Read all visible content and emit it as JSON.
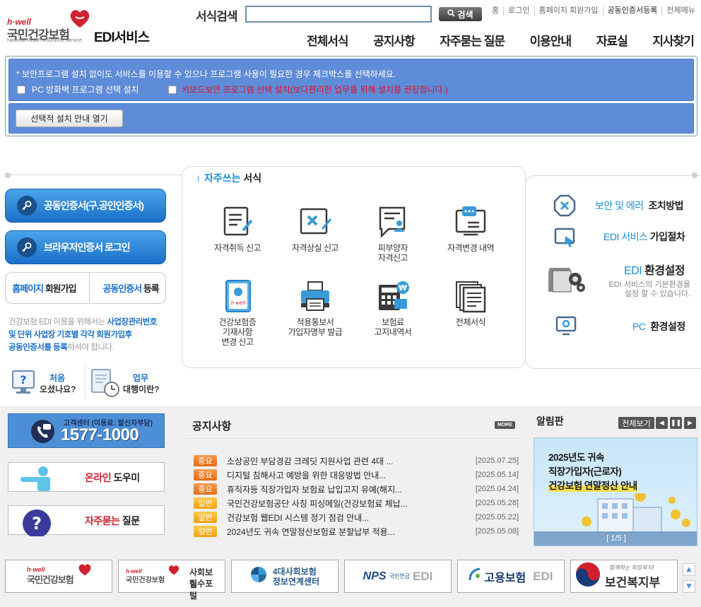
{
  "header": {
    "logo_hwell": "h·well",
    "logo_kr": "국민건강보험",
    "logo_en": "National Health Insurance Service",
    "logo_service": "EDI서비스",
    "search_label": "서식검색",
    "search_value": "",
    "search_button": "검색",
    "util_links": [
      "홈",
      "로그인",
      "홈페이지 회원가입",
      "공동인증서등록",
      "전체메뉴"
    ],
    "gnb": [
      "전체서식",
      "공지사항",
      "자주묻는 질문",
      "이용안내",
      "자료실",
      "지사찾기"
    ]
  },
  "install": {
    "notice": "* 보안프로그램 설치 없이도 서비스를 이용할 수 있으나 프로그램 사용이 필요한 경우 체크박스를 선택하세요.",
    "option1": "PC 방화벽 프로그램 선택 설치",
    "option2": "키보드보안 프로그램 선택 설치(보다편리한 업무를 위해 설치를 권장합니다.)",
    "guide_button": "선택적 설치 안내 열기"
  },
  "left": {
    "cert_login": "공동인증서(구.공인인증서)",
    "browser_login": "브라우저인증서 로그인",
    "join_a": "홈페이지",
    "join_b": "회원가입",
    "reg_a": "공동인증서",
    "reg_b": "등록",
    "guide_1": "건강보험 EDI 이용을 위해서는",
    "guide_1b": "사업장관리번호",
    "guide_2": "및 단위 사업장 기호별 각각 회원가입후",
    "guide_3": "공동인증서를 등록",
    "guide_3b": "하셔야 합니다.",
    "first_t1": "처음",
    "first_t2": "오셨나요?",
    "agency_t1": "업무",
    "agency_t2": "대행이란?"
  },
  "forms": {
    "title_hl": "자주쓰는",
    "title": "서식",
    "items": [
      {
        "label": "자격취득 신고"
      },
      {
        "label": "자격상실 신고"
      },
      {
        "label": "피부양자\n자격신고"
      },
      {
        "label": "자격변경 내역"
      },
      {
        "label": "건강보험증\n기재사항\n변경 신고"
      },
      {
        "label": "적용통보서\n가입자명부 발급"
      },
      {
        "label": "보험료\n고지내역서"
      },
      {
        "label": "전체서식"
      }
    ]
  },
  "right": {
    "error_a": "보안 및 에러",
    "error_b": "조치방법",
    "join_a": "EDI 서비스",
    "join_b": "가입절차",
    "env_a": "EDI",
    "env_b": "환경설정",
    "env_desc1": "EDI 서비스의 기본환경을",
    "env_desc2": "설정 할 수 있습니다.",
    "pc_a": "PC",
    "pc_b": "환경설정"
  },
  "callcenter": {
    "label": "고객센터 (이용료: 발신자부담)",
    "number": "1577-1000"
  },
  "helper_a": "온라인",
  "helper_b": "도우미",
  "faq_a": "자주묻는",
  "faq_b": "질문",
  "notice": {
    "title": "공지사항",
    "more": "MORE",
    "rows": [
      {
        "badge": "중요",
        "type": "red",
        "text": "소상공인 부담경감 크레딧 지원사업 관련 4대 ...",
        "date": "[2025.07.25]"
      },
      {
        "badge": "중요",
        "type": "red",
        "text": "디지털 침해사고 예방을 위한 대응방법 안내...",
        "date": "[2025.05.14]"
      },
      {
        "badge": "중요",
        "type": "red",
        "text": "휴직자등 직장가입자 보험료 납입고지 유예(해지...",
        "date": "[2025.04.24]"
      },
      {
        "badge": "일반",
        "type": "yel",
        "text": "국민건강보험공단 사칭 피싱메일(건강보험료 체납...",
        "date": "[2025.05.28]"
      },
      {
        "badge": "일반",
        "type": "yel",
        "text": "건강보험 웹EDI 시스템 정기 점검 안내...",
        "date": "[2025.05.22]"
      },
      {
        "badge": "일반",
        "type": "yel",
        "text": "2024년도 귀속 연말정산보험료 분할납부 적용...",
        "date": "[2025.05.08]"
      }
    ]
  },
  "alarm": {
    "title": "알림판",
    "all": "전체보기",
    "banner_l1": "2025년도 귀속",
    "banner_l2": "직장가입자(근로자)",
    "banner_l3": "건강보험 연말정산 안내",
    "pager": "[ 1/5 ]"
  },
  "footer": {
    "nhis": "국민건강보험",
    "portal_a": "사회보험",
    "portal_b": "징수포털",
    "center_a": "4대사회보험",
    "center_b": "정보연계센터",
    "nps": "EDI",
    "nps_label": "NPS",
    "nps_kr": "국민연금",
    "ei": "고용보험",
    "ei_edi": "EDI",
    "mohw_a": "보건복지부",
    "mohw_slogan": "함께하는 희망복지!"
  },
  "colors": {
    "accent_blue": "#1a8fd8",
    "install_bg": "#5f8cd8",
    "badge_important": "#e56a14",
    "badge_normal": "#f2a10c"
  }
}
